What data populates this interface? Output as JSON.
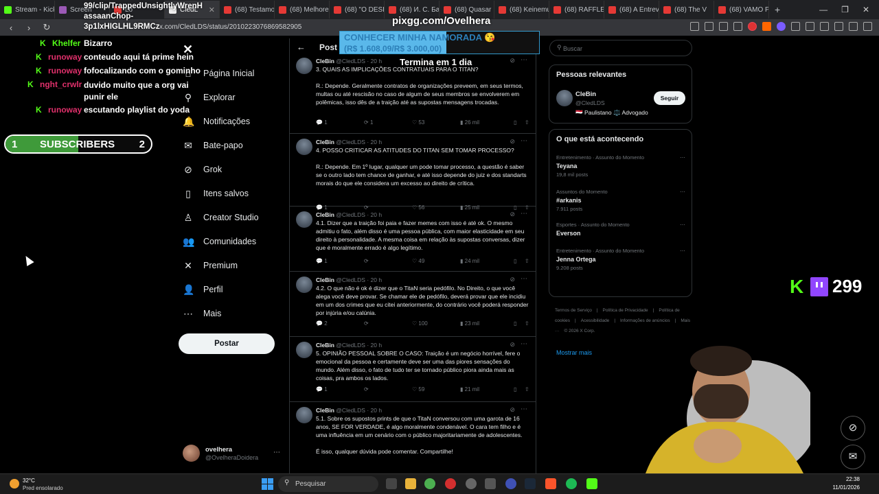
{
  "browser": {
    "tabs": [
      {
        "label": "Stream - Kick",
        "color": "#53fc18",
        "active": false
      },
      {
        "label": "Screen",
        "color": "#9b59b6",
        "active": false
      },
      {
        "label": "Lo",
        "color": "#e53935",
        "active": false
      },
      {
        "label": "CledL",
        "color": "#eeeeee",
        "active": true
      },
      {
        "label": "(68) Testamo",
        "color": "#e53935",
        "active": false
      },
      {
        "label": "(68) Melhores",
        "color": "#e53935",
        "active": false
      },
      {
        "label": "(68) \"O DESEN",
        "color": "#e53935",
        "active": false
      },
      {
        "label": "(68) И. С. Бах",
        "color": "#e53935",
        "active": false
      },
      {
        "label": "(68) Quasar",
        "color": "#e53935",
        "active": false
      },
      {
        "label": "(68) Keinemu",
        "color": "#e53935",
        "active": false
      },
      {
        "label": "(68) RAFFLES",
        "color": "#e53935",
        "active": false
      },
      {
        "label": "(68) A Entrev",
        "color": "#e53935",
        "active": false
      },
      {
        "label": "(68) The V",
        "color": "#e53935",
        "active": false
      },
      {
        "label": "(68) VAMO P",
        "color": "#e53935",
        "active": false
      }
    ],
    "url": "x.com/CledLDS/status/2010223076869582905"
  },
  "nav": {
    "items": [
      {
        "label": "Página Inicial",
        "icon": "home-icon",
        "glyph": "⌂"
      },
      {
        "label": "Explorar",
        "icon": "search-icon",
        "glyph": "⚲"
      },
      {
        "label": "Notificações",
        "icon": "bell-icon",
        "glyph": "🔔"
      },
      {
        "label": "Bate-papo",
        "icon": "mail-icon",
        "glyph": "✉"
      },
      {
        "label": "Grok",
        "icon": "grok-icon",
        "glyph": "⊘"
      },
      {
        "label": "Itens salvos",
        "icon": "bookmark-icon",
        "glyph": "▯"
      },
      {
        "label": "Creator Studio",
        "icon": "creator-icon",
        "glyph": "♙"
      },
      {
        "label": "Comunidades",
        "icon": "communities-icon",
        "glyph": "👥"
      },
      {
        "label": "Premium",
        "icon": "x-premium-icon",
        "glyph": "✕"
      },
      {
        "label": "Perfil",
        "icon": "profile-icon",
        "glyph": "👤"
      },
      {
        "label": "Mais",
        "icon": "more-icon",
        "glyph": "⋯"
      }
    ],
    "post_button": "Postar",
    "account": {
      "name": "ovelhera",
      "handle": "@OvelheraDoidera"
    }
  },
  "post": {
    "header": "Post",
    "tweets": [
      {
        "name": "CleBin",
        "handle": "@CledLDS",
        "time": "20 h",
        "text": "3. QUAIS AS IMPLICAÇÕES CONTRATUAIS PARA O TITAN?\n\nR.: Depende. Geralmente contratos de organizações preveem, em seus termos, multas ou até rescisão no caso de algum de seus membros se envolverem em polêmicas, isso dês de a traição até as supostas mensagens trocadas.",
        "replies": "1",
        "reposts": "1",
        "likes": "53",
        "views": "26 mil"
      },
      {
        "name": "CleBin",
        "handle": "@CledLDS",
        "time": "20 h",
        "text": "4. POSSO CRITICAR AS ATITUDES DO TITAN SEM TOMAR PROCESSO?\n\nR.: Depende. Em 1º lugar, qualquer um pode tomar processo, a questão é saber se o outro lado tem chance de ganhar, e até isso depende do juiz e dos standarts morais do que ele considera um excesso ao direito de crítica.",
        "replies": "1",
        "reposts": "",
        "likes": "56",
        "views": "25 mil"
      },
      {
        "name": "CleBin",
        "handle": "@CledLDS",
        "time": "20 h",
        "text": "4.1. Dizer que a traição foi paia e fazer memes com isso é até ok. O mesmo admitiu o fato, além disso é uma pessoa pública, com maior elasticidade em seu direito à personalidade. A mesma coisa em relação às supostas conversas, dizer que é moralmente errado é algo legítimo.",
        "replies": "1",
        "reposts": "",
        "likes": "49",
        "views": "24 mil"
      },
      {
        "name": "CleBin",
        "handle": "@CledLDS",
        "time": "20 h",
        "text": "4.2. O que não é ok é dizer que o TitaN seria pedófilo. No Direito, o que você alega você deve provar. Se chamar ele de pedófilo, deverá provar que ele incidiu em um dos crimes que eu citei anteriormente, do contrário você poderá responder por injúria e/ou calúnia.",
        "replies": "2",
        "reposts": "",
        "likes": "100",
        "views": "23 mil"
      },
      {
        "name": "CleBin",
        "handle": "@CledLDS",
        "time": "20 h",
        "text": "5. OPINIÃO PESSOAL SOBRE O CASO: Traição é um negócio horrível, fere o emocional da pessoa e certamente deve ser uma das piores sensações do mundo. Além disso, o fato de tudo ter se tornado público piora ainda mais as coisas, pra ambos os lados.",
        "replies": "1",
        "reposts": "",
        "likes": "59",
        "views": "21 mil"
      },
      {
        "name": "CleBin",
        "handle": "@CledLDS",
        "time": "20 h",
        "text": "5.1. Sobre os supostos prints de que o TitaN conversou com uma garota de 16 anos, SE FOR VERDADE, é algo moralmente condenável. O cara tem filho e é uma influência em um cenário com o público majoritariamente de adolescentes.\n\nÉ isso, qualquer dúvida pode comentar. Compartilhe!",
        "replies": "",
        "reposts": "",
        "likes": "",
        "views": ""
      }
    ]
  },
  "right": {
    "search_placeholder": "Buscar",
    "relevant_title": "Pessoas relevantes",
    "relevant": {
      "name": "CleBin",
      "handle": "@CledLDS",
      "bio": "🇾🇪 Paulistano ⚖️ Advogado",
      "follow": "Seguir"
    },
    "trends_title": "O que está acontecendo",
    "trends": [
      {
        "category": "Entretenimento · Assunto do Momento",
        "name": "Teyana",
        "posts": "19,8 mil posts"
      },
      {
        "category": "Assuntos do Momento",
        "name": "#arkanis",
        "posts": "7.911 posts"
      },
      {
        "category": "Esportes · Assunto do Momento",
        "name": "Everson",
        "posts": ""
      },
      {
        "category": "Entretenimento · Assunto do Momento",
        "name": "Jenna Ortega",
        "posts": "9.208 posts"
      }
    ],
    "show_more": "Mostrar mais",
    "footer": [
      "Termos de Serviço",
      "|",
      "Política de Privacidade",
      "|",
      "Política de cookies",
      "|",
      "Acessibilidade",
      "|",
      "Informações de anúncios",
      "|",
      "Mais ···",
      "© 2026 X Corp."
    ]
  },
  "overlay": {
    "chat": [
      {
        "user": "Khelfer",
        "msg": "Bizarro",
        "color": "#53fc18"
      },
      {
        "user": "runoway",
        "msg": "conteudo aqui tá prime hein",
        "color": "#e0306b"
      },
      {
        "user": "runoway",
        "msg": "fofocalizando com o gominho",
        "color": "#e0306b"
      },
      {
        "user": "nght_crwlr",
        "msg": "duvido muito que a org vai punir ele",
        "color": "#e0306b"
      },
      {
        "user": "runoway",
        "msg": "escutando playlist do yoda",
        "color": "#e0306b"
      }
    ],
    "subs": {
      "current": "1",
      "label": "SUBSCRIBERS",
      "goal": "2",
      "progress": 0.5
    },
    "clip_line1": "99/clip/TrappedUnsightlyWrenH",
    "clip_line2": "assaanChop-",
    "clip_line3": "3p1lxHIGLHL9RMCz",
    "pix": "pixgg.com/Ovelhera",
    "goal_title": "CONHECER MINHA NAMORADA 😘",
    "goal_amount": "(R$ 1.608,09/R$ 3.000,00)",
    "goal_progress": 0.536,
    "ends": "Termina em 1 dia",
    "viewers": "299"
  },
  "taskbar": {
    "temp": "32°C",
    "weather": "Pred ensolarado",
    "search": "Pesquisar",
    "time": "22:38",
    "date": "11/01/2026"
  }
}
